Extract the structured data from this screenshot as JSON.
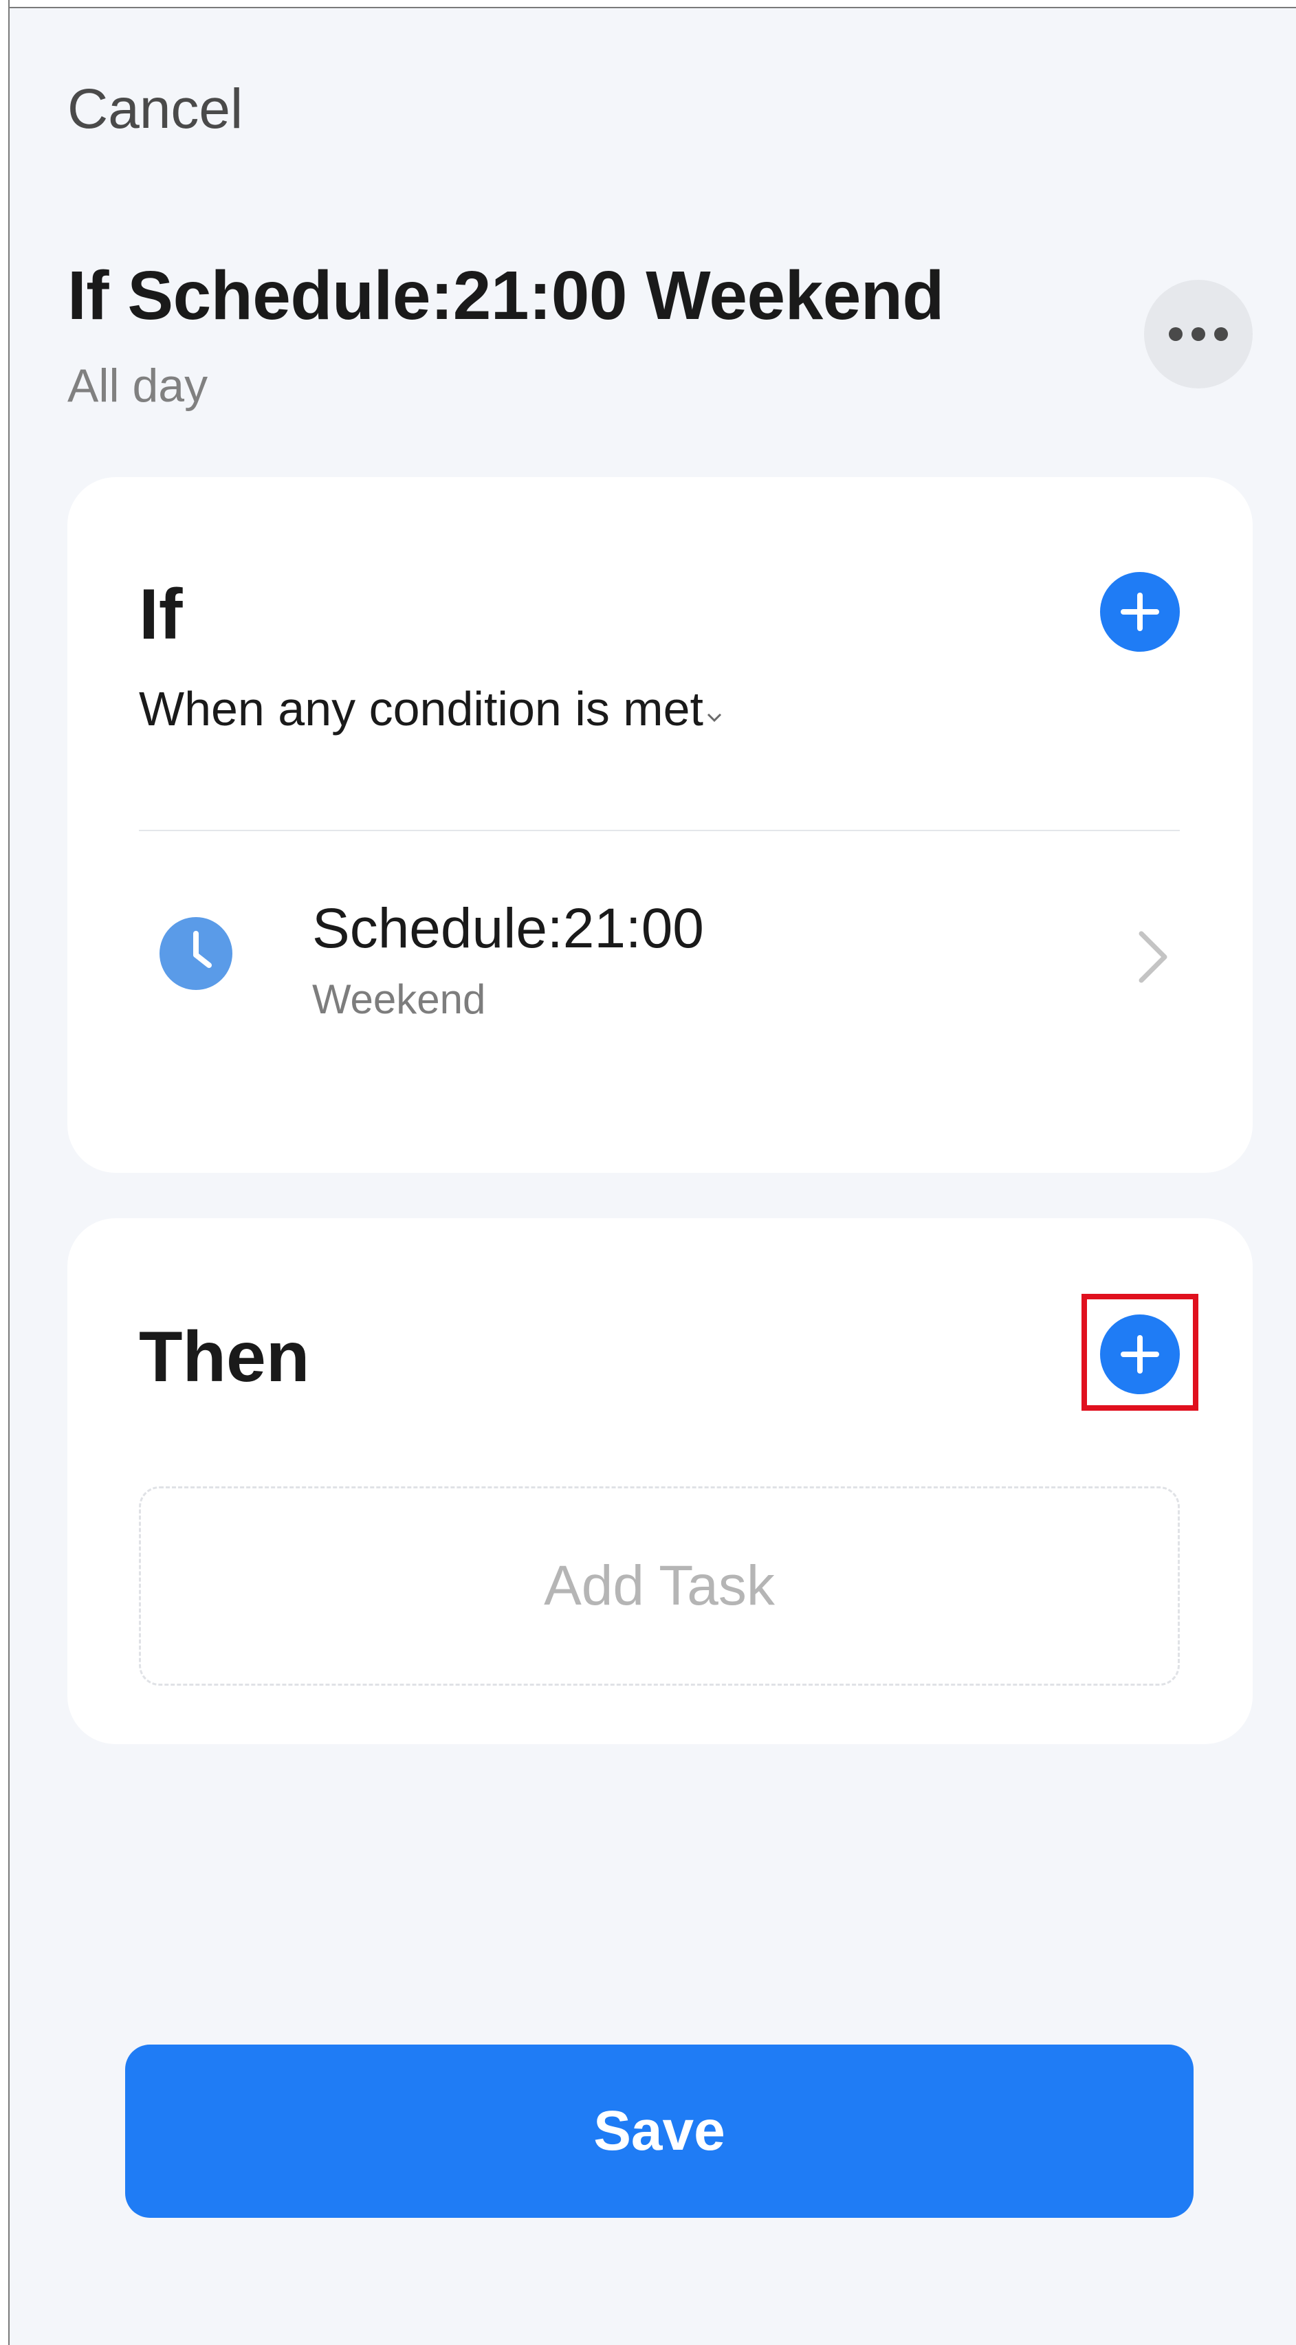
{
  "header": {
    "cancel_label": "Cancel"
  },
  "scene": {
    "title": "If Schedule:21:00 Weekend",
    "subtitle": "All day"
  },
  "if_section": {
    "heading": "If",
    "condition_mode": "When any condition is met",
    "conditions": [
      {
        "icon": "clock-icon",
        "title": "Schedule:21:00",
        "subtitle": "Weekend"
      }
    ]
  },
  "then_section": {
    "heading": "Then",
    "add_task_label": "Add Task"
  },
  "footer": {
    "save_label": "Save"
  },
  "colors": {
    "accent": "#1f7cf5",
    "background": "#f4f6fa",
    "card": "#ffffff",
    "highlight": "#e0101e",
    "clock": "#5a9be8"
  }
}
